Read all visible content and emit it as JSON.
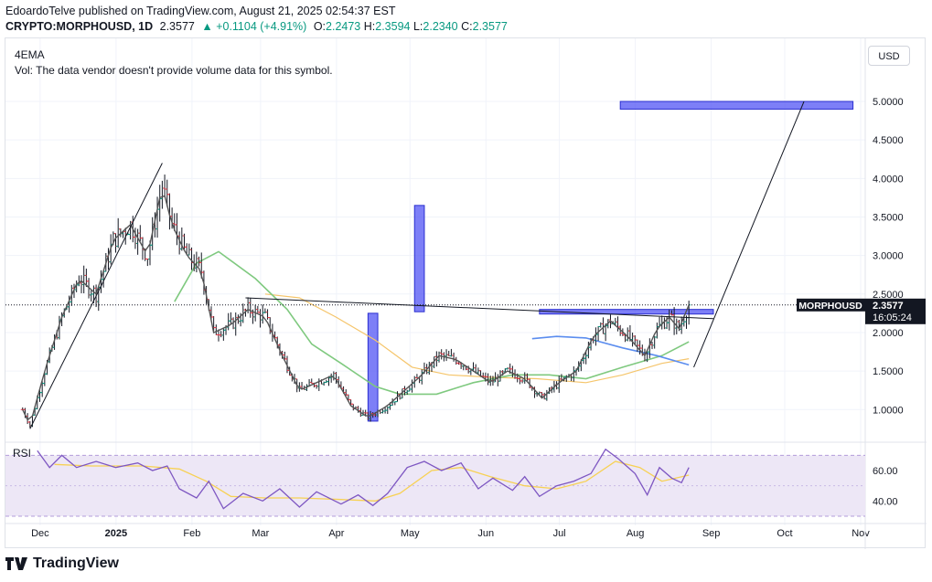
{
  "header": {
    "line1": "EdoardoTelve published on TradingView.com, August 21, 2025 02:54:37 EST",
    "symbol": "CRYPTO:MORPHOUSD, 1D",
    "price": "2.3577",
    "change": "▲ +0.1104 (+4.91%)",
    "o_label": "O:",
    "o": "2.2473",
    "h_label": "H:",
    "h": "2.3594",
    "l_label": "L:",
    "l": "2.2340",
    "c_label": "C:",
    "c": "2.3577"
  },
  "indicators": {
    "ema_label": "4EMA",
    "vol_label": "Vol: The data vendor doesn't provide volume data for this symbol.",
    "rsi_label": "RSI"
  },
  "currency_button": "USD",
  "price_tag": {
    "symbol": "MORPHOUSD",
    "price": "2.3577",
    "countdown": "16:05:24"
  },
  "footer": {
    "brand": "TradingView",
    "logo_icon": "tradingview-logo-icon"
  },
  "colors": {
    "up": "#089981",
    "down": "#f23645",
    "candle": "#131722",
    "ema_fast": "#555555",
    "ema_mid": "#7fc97f",
    "ema_slow": "#f5c56b",
    "ema_long": "#5b8def",
    "rsi": "#7e57c2",
    "rsi_ma": "#f7d154",
    "rsi_band": "#ede7f6",
    "box": "#5c5ff5"
  },
  "chart_data": [
    {
      "type": "candlestick",
      "title": "CRYPTO:MORPHOUSD, 1D",
      "x_ticks": [
        "Dec",
        "2025",
        "Feb",
        "Mar",
        "Apr",
        "May",
        "Jun",
        "Jul",
        "Aug",
        "Sep",
        "Oct",
        "Nov"
      ],
      "y_ticks": [
        "5.0000",
        "4.5000",
        "4.0000",
        "3.5000",
        "3.0000",
        "2.5000",
        "2.0000",
        "1.5000",
        "1.0000"
      ],
      "ylim": [
        0.6,
        5.7
      ],
      "scale": "linear",
      "grid": true,
      "last_price": 2.3577,
      "x_range": [
        "2024-11-15",
        "2025-11-01"
      ],
      "price_path": [
        [
          "2024-11-22",
          1.0
        ],
        [
          "2024-11-25",
          0.8
        ],
        [
          "2024-12-01",
          1.5
        ],
        [
          "2024-12-08",
          2.2
        ],
        [
          "2024-12-15",
          2.7
        ],
        [
          "2024-12-22",
          2.5
        ],
        [
          "2024-12-29",
          3.2
        ],
        [
          "2025-01-05",
          3.4
        ],
        [
          "2025-01-12",
          3.0
        ],
        [
          "2025-01-18",
          3.9
        ],
        [
          "2025-01-22",
          3.4
        ],
        [
          "2025-01-28",
          3.0
        ],
        [
          "2025-02-03",
          2.8
        ],
        [
          "2025-02-08",
          2.0
        ],
        [
          "2025-02-15",
          2.1
        ],
        [
          "2025-02-22",
          2.3
        ],
        [
          "2025-03-01",
          2.2
        ],
        [
          "2025-03-08",
          1.7
        ],
        [
          "2025-03-15",
          1.25
        ],
        [
          "2025-03-22",
          1.35
        ],
        [
          "2025-03-29",
          1.45
        ],
        [
          "2025-04-05",
          1.05
        ],
        [
          "2025-04-12",
          0.9
        ],
        [
          "2025-04-20",
          1.05
        ],
        [
          "2025-04-27",
          1.25
        ],
        [
          "2025-05-04",
          1.45
        ],
        [
          "2025-05-11",
          1.7
        ],
        [
          "2025-05-18",
          1.65
        ],
        [
          "2025-05-25",
          1.5
        ],
        [
          "2025-06-01",
          1.35
        ],
        [
          "2025-06-08",
          1.5
        ],
        [
          "2025-06-15",
          1.4
        ],
        [
          "2025-06-22",
          1.15
        ],
        [
          "2025-06-29",
          1.35
        ],
        [
          "2025-07-06",
          1.5
        ],
        [
          "2025-07-13",
          1.95
        ],
        [
          "2025-07-20",
          2.15
        ],
        [
          "2025-07-27",
          1.95
        ],
        [
          "2025-08-03",
          1.7
        ],
        [
          "2025-08-08",
          2.05
        ],
        [
          "2025-08-13",
          2.2
        ],
        [
          "2025-08-17",
          2.05
        ],
        [
          "2025-08-21",
          2.3577
        ]
      ],
      "ema_mid": [
        [
          "2025-01-23",
          2.4
        ],
        [
          "2025-02-01",
          2.9
        ],
        [
          "2025-02-10",
          3.05
        ],
        [
          "2025-02-25",
          2.7
        ],
        [
          "2025-03-10",
          2.3
        ],
        [
          "2025-03-20",
          1.85
        ],
        [
          "2025-04-01",
          1.6
        ],
        [
          "2025-04-15",
          1.3
        ],
        [
          "2025-04-25",
          1.2
        ],
        [
          "2025-05-10",
          1.2
        ],
        [
          "2025-05-25",
          1.35
        ],
        [
          "2025-06-10",
          1.45
        ],
        [
          "2025-06-25",
          1.45
        ],
        [
          "2025-07-10",
          1.4
        ],
        [
          "2025-07-25",
          1.55
        ],
        [
          "2025-08-10",
          1.7
        ],
        [
          "2025-08-21",
          1.88
        ]
      ],
      "ema_slow": [
        [
          "2025-03-01",
          2.5
        ],
        [
          "2025-03-15",
          2.45
        ],
        [
          "2025-03-30",
          2.2
        ],
        [
          "2025-04-15",
          1.9
        ],
        [
          "2025-04-30",
          1.55
        ],
        [
          "2025-05-15",
          1.45
        ],
        [
          "2025-06-01",
          1.42
        ],
        [
          "2025-06-20",
          1.4
        ],
        [
          "2025-07-10",
          1.35
        ],
        [
          "2025-07-25",
          1.45
        ],
        [
          "2025-08-10",
          1.6
        ],
        [
          "2025-08-21",
          1.66
        ]
      ],
      "ema_long": [
        [
          "2025-06-18",
          1.92
        ],
        [
          "2025-06-28",
          1.95
        ],
        [
          "2025-07-10",
          1.93
        ],
        [
          "2025-07-25",
          1.8
        ],
        [
          "2025-08-08",
          1.7
        ],
        [
          "2025-08-21",
          1.58
        ]
      ],
      "trendlines": [
        {
          "from": [
            "2024-11-25",
            0.75
          ],
          "to": [
            "2025-01-18",
            4.2
          ]
        },
        {
          "from": [
            "2025-02-21",
            2.45
          ],
          "to": [
            "2025-08-31",
            2.18
          ]
        },
        {
          "from": [
            "2025-08-23",
            1.55
          ],
          "to": [
            "2025-10-07",
            5.0
          ]
        }
      ],
      "boxes": [
        {
          "from": [
            "2025-04-12",
            2.25
          ],
          "to": [
            "2025-04-16",
            0.85
          ]
        },
        {
          "from": [
            "2025-05-01",
            3.65
          ],
          "to": [
            "2025-05-05",
            2.27
          ]
        },
        {
          "from": [
            "2025-06-21",
            2.3
          ],
          "to": [
            "2025-08-31",
            2.24
          ]
        },
        {
          "from": [
            "2025-07-24",
            5.0
          ],
          "to": [
            "2025-10-27",
            4.9
          ]
        }
      ]
    },
    {
      "type": "line",
      "title": "RSI",
      "y_ticks": [
        "60.00",
        "40.00"
      ],
      "ylim": [
        30,
        75
      ],
      "bands": [
        70,
        30
      ],
      "grid": true,
      "series": [
        {
          "values": [
            [
              "2024-11-28",
              73
            ],
            [
              "2024-12-03",
              62
            ],
            [
              "2024-12-08",
              70
            ],
            [
              "2024-12-14",
              62
            ],
            [
              "2024-12-22",
              66
            ],
            [
              "2024-12-30",
              62
            ],
            [
              "2025-01-08",
              65
            ],
            [
              "2025-01-14",
              60
            ],
            [
              "2025-01-20",
              63
            ],
            [
              "2025-01-25",
              48
            ],
            [
              "2025-02-01",
              42
            ],
            [
              "2025-02-06",
              53
            ],
            [
              "2025-02-12",
              35
            ],
            [
              "2025-02-20",
              45
            ],
            [
              "2025-02-28",
              40
            ],
            [
              "2025-03-07",
              48
            ],
            [
              "2025-03-15",
              36
            ],
            [
              "2025-03-22",
              46
            ],
            [
              "2025-04-01",
              38
            ],
            [
              "2025-04-08",
              44
            ],
            [
              "2025-04-14",
              37
            ],
            [
              "2025-04-20",
              45
            ],
            [
              "2025-04-28",
              62
            ],
            [
              "2025-05-05",
              66
            ],
            [
              "2025-05-12",
              60
            ],
            [
              "2025-05-20",
              65
            ],
            [
              "2025-05-27",
              48
            ],
            [
              "2025-06-02",
              55
            ],
            [
              "2025-06-10",
              47
            ],
            [
              "2025-06-15",
              56
            ],
            [
              "2025-06-21",
              43
            ],
            [
              "2025-06-28",
              50
            ],
            [
              "2025-07-05",
              53
            ],
            [
              "2025-07-12",
              58
            ],
            [
              "2025-07-18",
              74
            ],
            [
              "2025-07-23",
              68
            ],
            [
              "2025-07-30",
              58
            ],
            [
              "2025-08-04",
              44
            ],
            [
              "2025-08-09",
              62
            ],
            [
              "2025-08-14",
              55
            ],
            [
              "2025-08-18",
              52
            ],
            [
              "2025-08-21",
              62
            ]
          ]
        },
        {
          "values": [
            [
              "2024-12-05",
              64
            ],
            [
              "2024-12-20",
              63
            ],
            [
              "2025-01-10",
              63
            ],
            [
              "2025-01-25",
              61
            ],
            [
              "2025-02-05",
              53
            ],
            [
              "2025-02-15",
              43
            ],
            [
              "2025-03-01",
              42
            ],
            [
              "2025-03-15",
              42
            ],
            [
              "2025-04-01",
              41
            ],
            [
              "2025-04-15",
              40
            ],
            [
              "2025-04-25",
              45
            ],
            [
              "2025-05-08",
              60
            ],
            [
              "2025-05-20",
              62
            ],
            [
              "2025-06-01",
              56
            ],
            [
              "2025-06-15",
              50
            ],
            [
              "2025-06-28",
              48
            ],
            [
              "2025-07-10",
              53
            ],
            [
              "2025-07-22",
              66
            ],
            [
              "2025-08-01",
              62
            ],
            [
              "2025-08-10",
              53
            ],
            [
              "2025-08-21",
              57
            ]
          ]
        }
      ]
    }
  ]
}
